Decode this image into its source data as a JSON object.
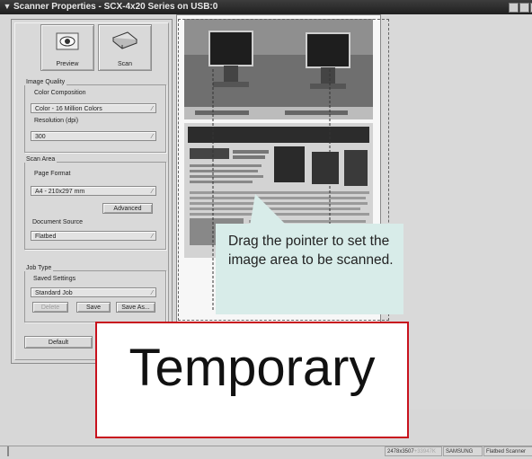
{
  "window": {
    "title": "Scanner Properties - SCX-4x20 Series on USB:0"
  },
  "toolbar": {
    "preview_label": "Preview",
    "scan_label": "Scan"
  },
  "image_quality": {
    "group_label": "Image Quality",
    "color_composition_label": "Color Composition",
    "color_composition_value": "Color - 16 Million Colors",
    "resolution_label": "Resolution (dpi)",
    "resolution_value": "300"
  },
  "scan_area": {
    "group_label": "Scan Area",
    "page_format_label": "Page Format",
    "page_format_value": "A4 - 210x297 mm",
    "advanced_label": "Advanced",
    "document_source_label": "Document Source",
    "document_source_value": "Flatbed"
  },
  "job_type": {
    "group_label": "Job Type",
    "saved_settings_label": "Saved Settings",
    "saved_settings_value": "Standard Job",
    "delete_label": "Delete",
    "save_label": "Save",
    "save_as_label": "Save As..."
  },
  "bottom": {
    "default_label": "Default"
  },
  "status": {
    "dimensions": "2478x3507",
    "dimensions_extra": "+33947K",
    "manufacturer": "SAMSUNG",
    "device": "Flatbed Scanner"
  },
  "callout": {
    "text": "Drag the pointer to set the image area to be scanned."
  },
  "overlay": {
    "stamp": "Temporary"
  },
  "colors": {
    "titlebar": "#2b2b2b",
    "callout_bg": "#d8ece9",
    "stamp_border": "#c8111d"
  },
  "icons": [
    "menu-arrow-icon",
    "minimize-icon",
    "maximize-icon",
    "close-icon",
    "eye-icon",
    "scanner-icon",
    "chevron-down-icon"
  ]
}
